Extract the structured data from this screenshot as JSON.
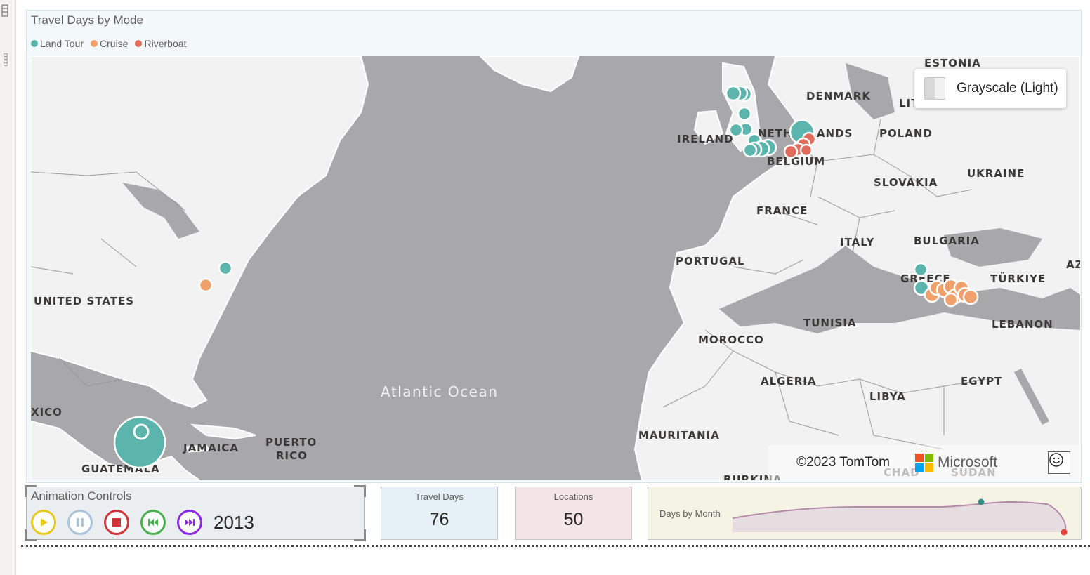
{
  "map_visual": {
    "title": "Travel Days by Mode",
    "legend": [
      {
        "label": "Land Tour",
        "color": "#5bb5ac"
      },
      {
        "label": "Cruise",
        "color": "#f0a06a"
      },
      {
        "label": "Riverboat",
        "color": "#e06c5e"
      }
    ],
    "map_style_label": "Grayscale (Light)",
    "ocean_label": "Atlantic Ocean",
    "country_labels": [
      "ESTONIA",
      "DENMARK",
      "LIT",
      "IRELAND",
      "NETHERLANDS",
      "POLAND",
      "BELGIUM",
      "UKRAINE",
      "SLOVAKIA",
      "FRANCE",
      "ITALY",
      "BULGARIA",
      "PORTUGAL",
      "GREECE",
      "TÜRKIYE",
      "AZ",
      "UNITED STATES",
      "TUNISIA",
      "LEBANON",
      "MOROCCO",
      "ALGERIA",
      "EGYPT",
      "LIBYA",
      "XICO",
      "MAURITANIA",
      "JAMAICA",
      "PUERTO",
      "RICO",
      "GUATEMALA",
      "CHAD",
      "SUDAN",
      "BURKINA"
    ],
    "copyright": "©2023 TomTom",
    "brand": "Microsoft",
    "feedback_icon": "smiley-icon"
  },
  "animation_controls": {
    "title": "Animation Controls",
    "year": "2013",
    "buttons": [
      {
        "name": "play",
        "icon": "play-icon",
        "color": "#e8c920"
      },
      {
        "name": "pause",
        "icon": "pause-icon",
        "color": "#aac4dc"
      },
      {
        "name": "stop",
        "icon": "stop-icon",
        "color": "#d13438"
      },
      {
        "name": "rewind",
        "icon": "skip-back-icon",
        "color": "#4caf50"
      },
      {
        "name": "forward",
        "icon": "skip-forward-icon",
        "color": "#8a2be2"
      }
    ]
  },
  "kpis": [
    {
      "title": "Travel Days",
      "value": "76",
      "color": "#e5f1f7"
    },
    {
      "title": "Locations",
      "value": "50",
      "color": "#f3e4e6"
    }
  ],
  "sparkline": {
    "title": "Days by Month",
    "line_color": "#b48aa8",
    "fill_color": "#e6dde0",
    "high_point_color": "#3a8f88",
    "low_point_color": "#e0443c"
  }
}
